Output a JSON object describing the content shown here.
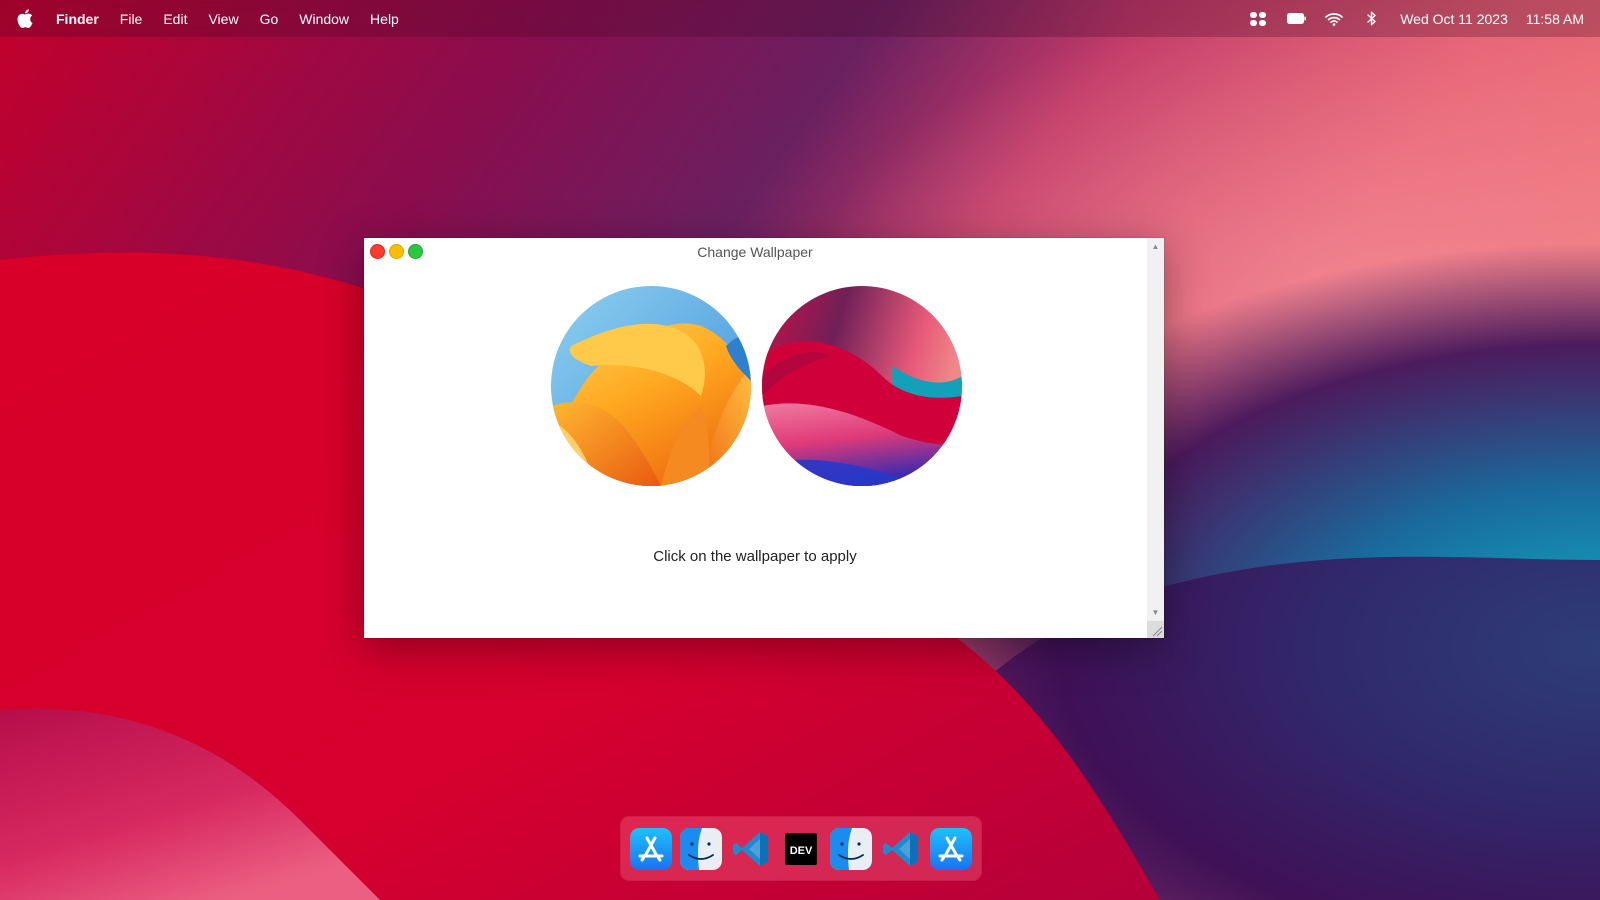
{
  "menubar": {
    "apple_icon": "apple-logo-icon",
    "app_name": "Finder",
    "items": [
      "File",
      "Edit",
      "View",
      "Go",
      "Window",
      "Help"
    ],
    "status_icons": [
      "control-center-icon",
      "battery-icon",
      "wifi-icon",
      "bluetooth-icon"
    ],
    "date": "Wed Oct 11 2023",
    "time": "11:58 AM"
  },
  "window": {
    "title": "Change Wallpaper",
    "hint": "Click on the wallpaper to apply",
    "wallpapers": [
      {
        "name": "ventura-wallpaper",
        "icon": "ventura-thumbnail"
      },
      {
        "name": "big-sur-wallpaper",
        "icon": "big-sur-thumbnail"
      }
    ],
    "traffic_light_colors": {
      "close": "#ff3b30",
      "minimize": "#ffbd00",
      "maximize": "#28c840"
    }
  },
  "dock": {
    "items": [
      {
        "icon": "app-store-icon"
      },
      {
        "icon": "finder-icon"
      },
      {
        "icon": "vscode-icon"
      },
      {
        "icon": "dev-icon",
        "label": "DEV"
      },
      {
        "icon": "finder-icon"
      },
      {
        "icon": "vscode-icon"
      },
      {
        "icon": "app-store-icon"
      }
    ]
  },
  "colors": {
    "wallpaper_primary": "#d4002a",
    "wallpaper_accent_teal": "#1aa6c2",
    "wallpaper_accent_purple": "#3a0d5c"
  }
}
